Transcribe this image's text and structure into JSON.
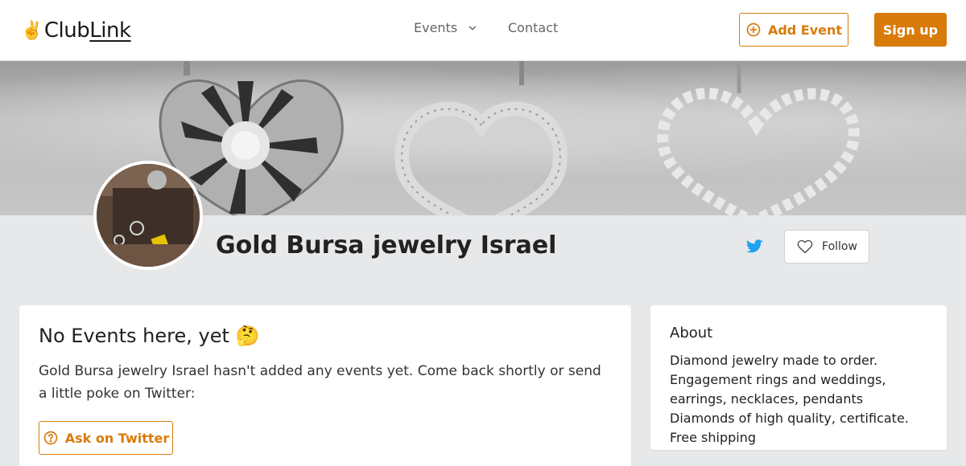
{
  "header": {
    "logo_prefix": "Club",
    "logo_suffix": "Link",
    "nav_events": "Events",
    "nav_contact": "Contact",
    "add_event_label": "Add Event",
    "signup_label": "Sign up"
  },
  "profile": {
    "title": "Gold Bursa jewelry Israel",
    "follow_label": "Follow"
  },
  "events_card": {
    "heading": "No Events here, yet 🤔",
    "message": "Gold Bursa jewelry Israel hasn't added any events yet. Come back shortly or send a little poke on Twitter:",
    "ask_label": "Ask on Twitter"
  },
  "about_card": {
    "heading": "About",
    "text": "Diamond jewelry made to order. Engagement rings and weddings, earrings, necklaces, pendants Diamonds of high quality, certificate. Free shipping"
  },
  "colors": {
    "accent": "#d97b0a",
    "twitter": "#1da1f2",
    "page_bg": "#e7e8ea"
  },
  "icons": {
    "logo": "victory-hand-icon",
    "events_dropdown": "chevron-down-icon",
    "add_event": "plus-circle-icon",
    "twitter": "twitter-icon",
    "follow": "heart-icon",
    "ask": "help-circle-icon"
  }
}
